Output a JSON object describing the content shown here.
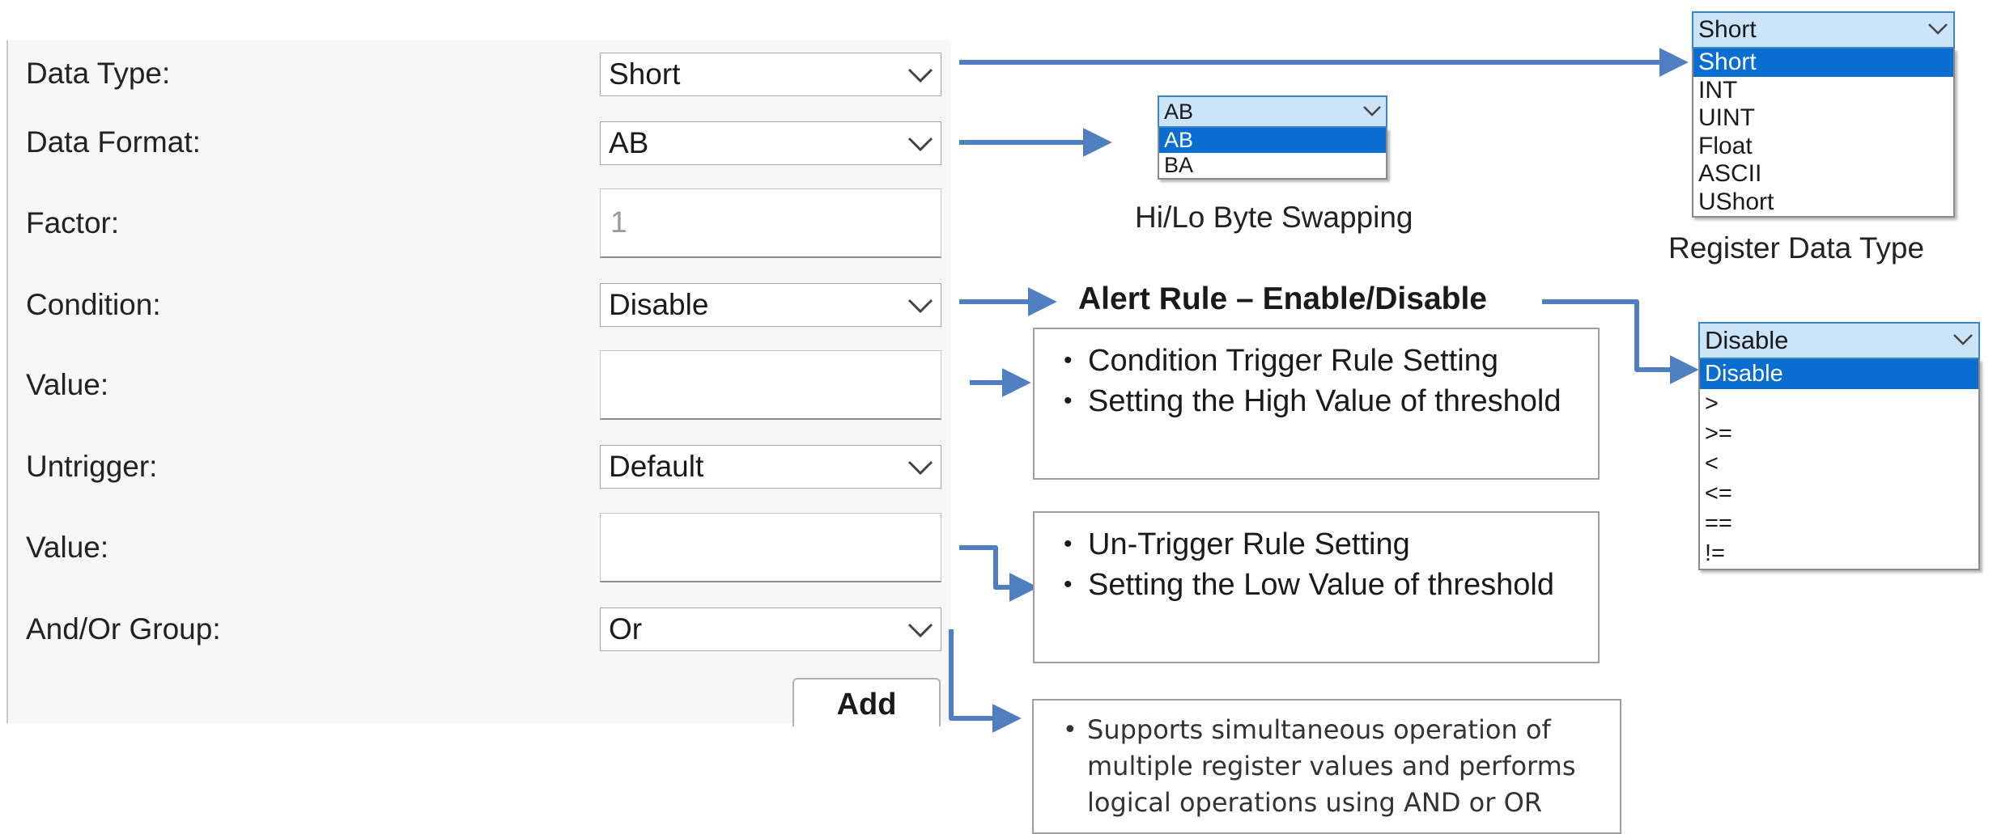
{
  "form": {
    "data_type_label": "Data Type:",
    "data_type_value": "Short",
    "data_format_label": "Data Format:",
    "data_format_value": "AB",
    "factor_label": "Factor:",
    "factor_value": "1",
    "condition_label": "Condition:",
    "condition_value": "Disable",
    "value1_label": "Value:",
    "value1_value": "",
    "untrigger_label": "Untrigger:",
    "untrigger_value": "Default",
    "value2_label": "Value:",
    "value2_value": "",
    "group_label": "And/Or Group:",
    "group_value": "Or",
    "add_label": "Add"
  },
  "format_dropdown": {
    "selected": "AB",
    "options": [
      "AB",
      "BA"
    ],
    "caption": "Hi/Lo Byte Swapping"
  },
  "type_dropdown": {
    "selected": "Short",
    "options": [
      "Short",
      "INT",
      "UINT",
      "Float",
      "ASCII",
      "UShort"
    ],
    "caption": "Register Data Type"
  },
  "condition_dropdown": {
    "selected": "Disable",
    "options": [
      "Disable",
      ">",
      ">=",
      "<",
      "<=",
      "==",
      "!="
    ]
  },
  "alert_rule_heading": "Alert Rule – Enable/Disable",
  "trigger_note": [
    "Condition Trigger Rule Setting",
    "Setting the High Value of threshold"
  ],
  "untrigger_note": [
    "Un-Trigger Rule Setting",
    "Setting the Low Value of threshold"
  ],
  "group_note": [
    "Supports simultaneous operation of multiple register values and performs logical operations using AND or OR"
  ],
  "colors": {
    "arrow": "#4f7fc0",
    "selected": "#0a6ed1",
    "dropdown_header": "#cce4f7"
  },
  "icons": {
    "dropdown": "chevron-down-icon",
    "arrow": "arrow-right-icon"
  }
}
